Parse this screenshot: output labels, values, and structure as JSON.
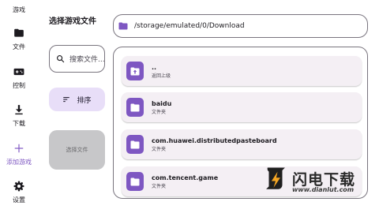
{
  "nav": {
    "items": [
      {
        "label": "游戏",
        "icon": "gamepad-icon"
      },
      {
        "label": "文件",
        "icon": "folder-icon"
      },
      {
        "label": "控制",
        "icon": "controller-icon"
      },
      {
        "label": "下载",
        "icon": "download-icon"
      },
      {
        "label": "添加游戏",
        "icon": "plus-icon",
        "active": true
      },
      {
        "label": "设置",
        "icon": "gear-icon"
      }
    ]
  },
  "panel": {
    "title": "选择游戏文件",
    "search_placeholder": "搜索文件...",
    "sort_label": "排序",
    "select_label": "选择文件"
  },
  "path": {
    "current": "/storage/emulated/0/Download",
    "icon": "folder-icon"
  },
  "files": [
    {
      "name": "..",
      "subtitle": "返回上级",
      "icon": "folder-up-icon"
    },
    {
      "name": "baidu",
      "subtitle": "文件夹",
      "icon": "folder-icon"
    },
    {
      "name": "com.huawei.distributedpasteboard",
      "subtitle": "文件夹",
      "icon": "folder-icon"
    },
    {
      "name": "com.tencent.game",
      "subtitle": "文件夹",
      "icon": "folder-icon"
    }
  ],
  "watermark": {
    "title": "闪电下载",
    "url": "www.dianlut.com"
  },
  "colors": {
    "accent": "#7e57c2",
    "sort_bg": "#e8def8",
    "select_bg": "#c7c7c9",
    "item_bg": "#f4eff4",
    "outline": "#79747e"
  }
}
